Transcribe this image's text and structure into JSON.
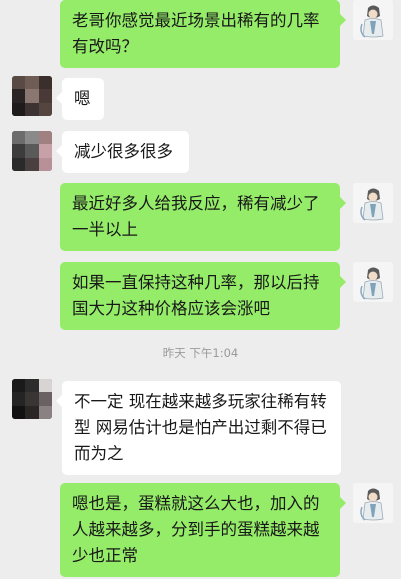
{
  "messages": [
    {
      "sender": "me",
      "text": "老哥你感觉最近场景出稀有的几率有改吗？"
    },
    {
      "sender": "other",
      "text": "嗯"
    },
    {
      "sender": "other",
      "text": "减少很多很多"
    },
    {
      "sender": "me",
      "text": "最近好多人给我反应，稀有减少了一半以上"
    },
    {
      "sender": "me",
      "text": "如果一直保持这种几率，那以后持国大力这种价格应该会涨吧"
    },
    {
      "sender": "other",
      "text": "不一定 现在越来越多玩家往稀有转型 网易估计也是怕产出过剩不得已而为之"
    },
    {
      "sender": "me",
      "text": "嗯也是，蛋糕就这么大也，加入的人越来越多，分到手的蛋糕越来越少也正常"
    }
  ],
  "timestamp": "昨天 下午1:04",
  "colors": {
    "background": "#ededed",
    "my_bubble": "#95ec69",
    "their_bubble": "#ffffff",
    "timestamp_text": "#9a9a9a"
  }
}
